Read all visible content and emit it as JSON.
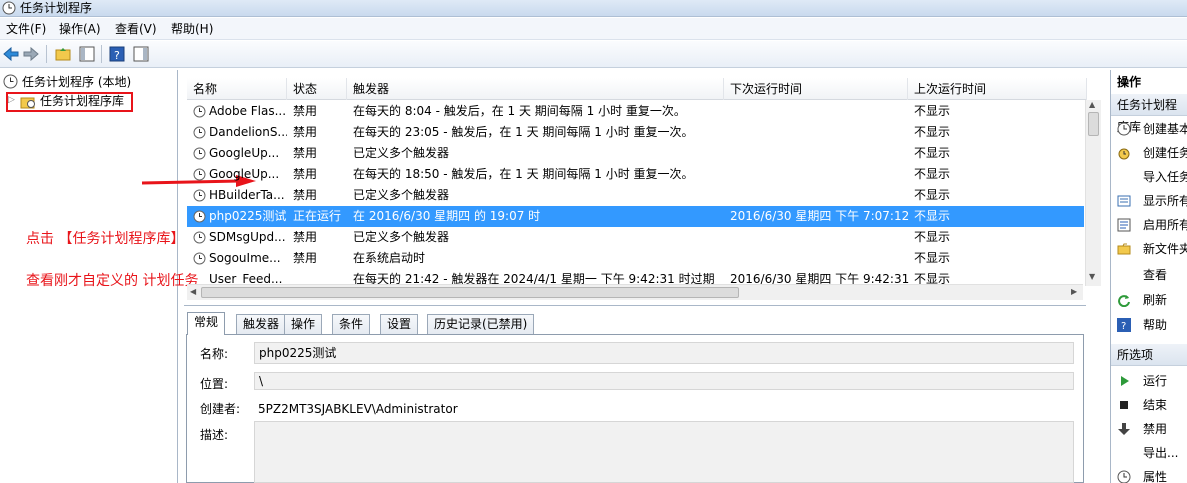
{
  "window": {
    "title": "任务计划程序"
  },
  "menu": [
    "文件(F)",
    "操作(A)",
    "查看(V)",
    "帮助(H)"
  ],
  "tree": {
    "root": "任务计划程序 (本地)",
    "child": "任务计划程序库"
  },
  "list": {
    "columns": [
      "名称",
      "状态",
      "触发器",
      "下次运行时间",
      "上次运行时间"
    ],
    "rows": [
      {
        "name": "Adobe Flas...",
        "status": "禁用",
        "trigger": "在每天的 8:04 - 触发后，在 1 天 期间每隔 1 小时 重复一次。",
        "next": "",
        "last": "不显示"
      },
      {
        "name": "DandelionS...",
        "status": "禁用",
        "trigger": "在每天的 23:05 - 触发后，在 1 天 期间每隔 1 小时 重复一次。",
        "next": "",
        "last": "不显示"
      },
      {
        "name": "GoogleUp...",
        "status": "禁用",
        "trigger": "已定义多个触发器",
        "next": "",
        "last": "不显示"
      },
      {
        "name": "GoogleUp...",
        "status": "禁用",
        "trigger": "在每天的 18:50 - 触发后，在 1 天 期间每隔 1 小时 重复一次。",
        "next": "",
        "last": "不显示"
      },
      {
        "name": "HBuilderTa...",
        "status": "禁用",
        "trigger": "已定义多个触发器",
        "next": "",
        "last": "不显示"
      },
      {
        "name": "php0225测试",
        "status": "正在运行",
        "trigger": "在 2016/6/30 星期四 的 19:07 时",
        "next": "2016/6/30 星期四 下午 7:07:12",
        "last": "不显示"
      },
      {
        "name": "SDMsgUpd...",
        "status": "禁用",
        "trigger": "已定义多个触发器",
        "next": "",
        "last": "不显示"
      },
      {
        "name": "SogouIme...",
        "status": "禁用",
        "trigger": "在系统启动时",
        "next": "",
        "last": "不显示"
      },
      {
        "name": "User_Feed...",
        "status": "",
        "trigger": "在每天的 21:42 - 触发器在 2024/4/1 星期一 下午 9:42:31 时过期",
        "next": "2016/6/30 星期四 下午 9:42:31",
        "last": "不显示"
      }
    ]
  },
  "tabs": [
    "常规",
    "触发器",
    "操作",
    "条件",
    "设置",
    "历史记录(已禁用)"
  ],
  "detail": {
    "name_label": "名称:",
    "name_value": "php0225测试",
    "location_label": "位置:",
    "location_value": "\\",
    "author_label": "创建者:",
    "author_value": "5PZ2MT3SJABKLEV\\Administrator",
    "desc_label": "描述:"
  },
  "actions": {
    "header": "操作",
    "section1": "任务计划程序库",
    "items1": [
      "创建基本",
      "创建任务",
      "导入任务",
      "显示所有",
      "启用所有",
      "新文件夹",
      "查看",
      "刷新",
      "帮助"
    ],
    "header2": "所选项",
    "items2": [
      "运行",
      "结束",
      "禁用",
      "导出...",
      "属性"
    ]
  },
  "annotations": {
    "line1": "点击 【任务计划程序库】",
    "line2": "查看刚才自定义的 计划任务"
  },
  "colors": {
    "selection": "#3399ff",
    "annotation": "#e8141a"
  }
}
